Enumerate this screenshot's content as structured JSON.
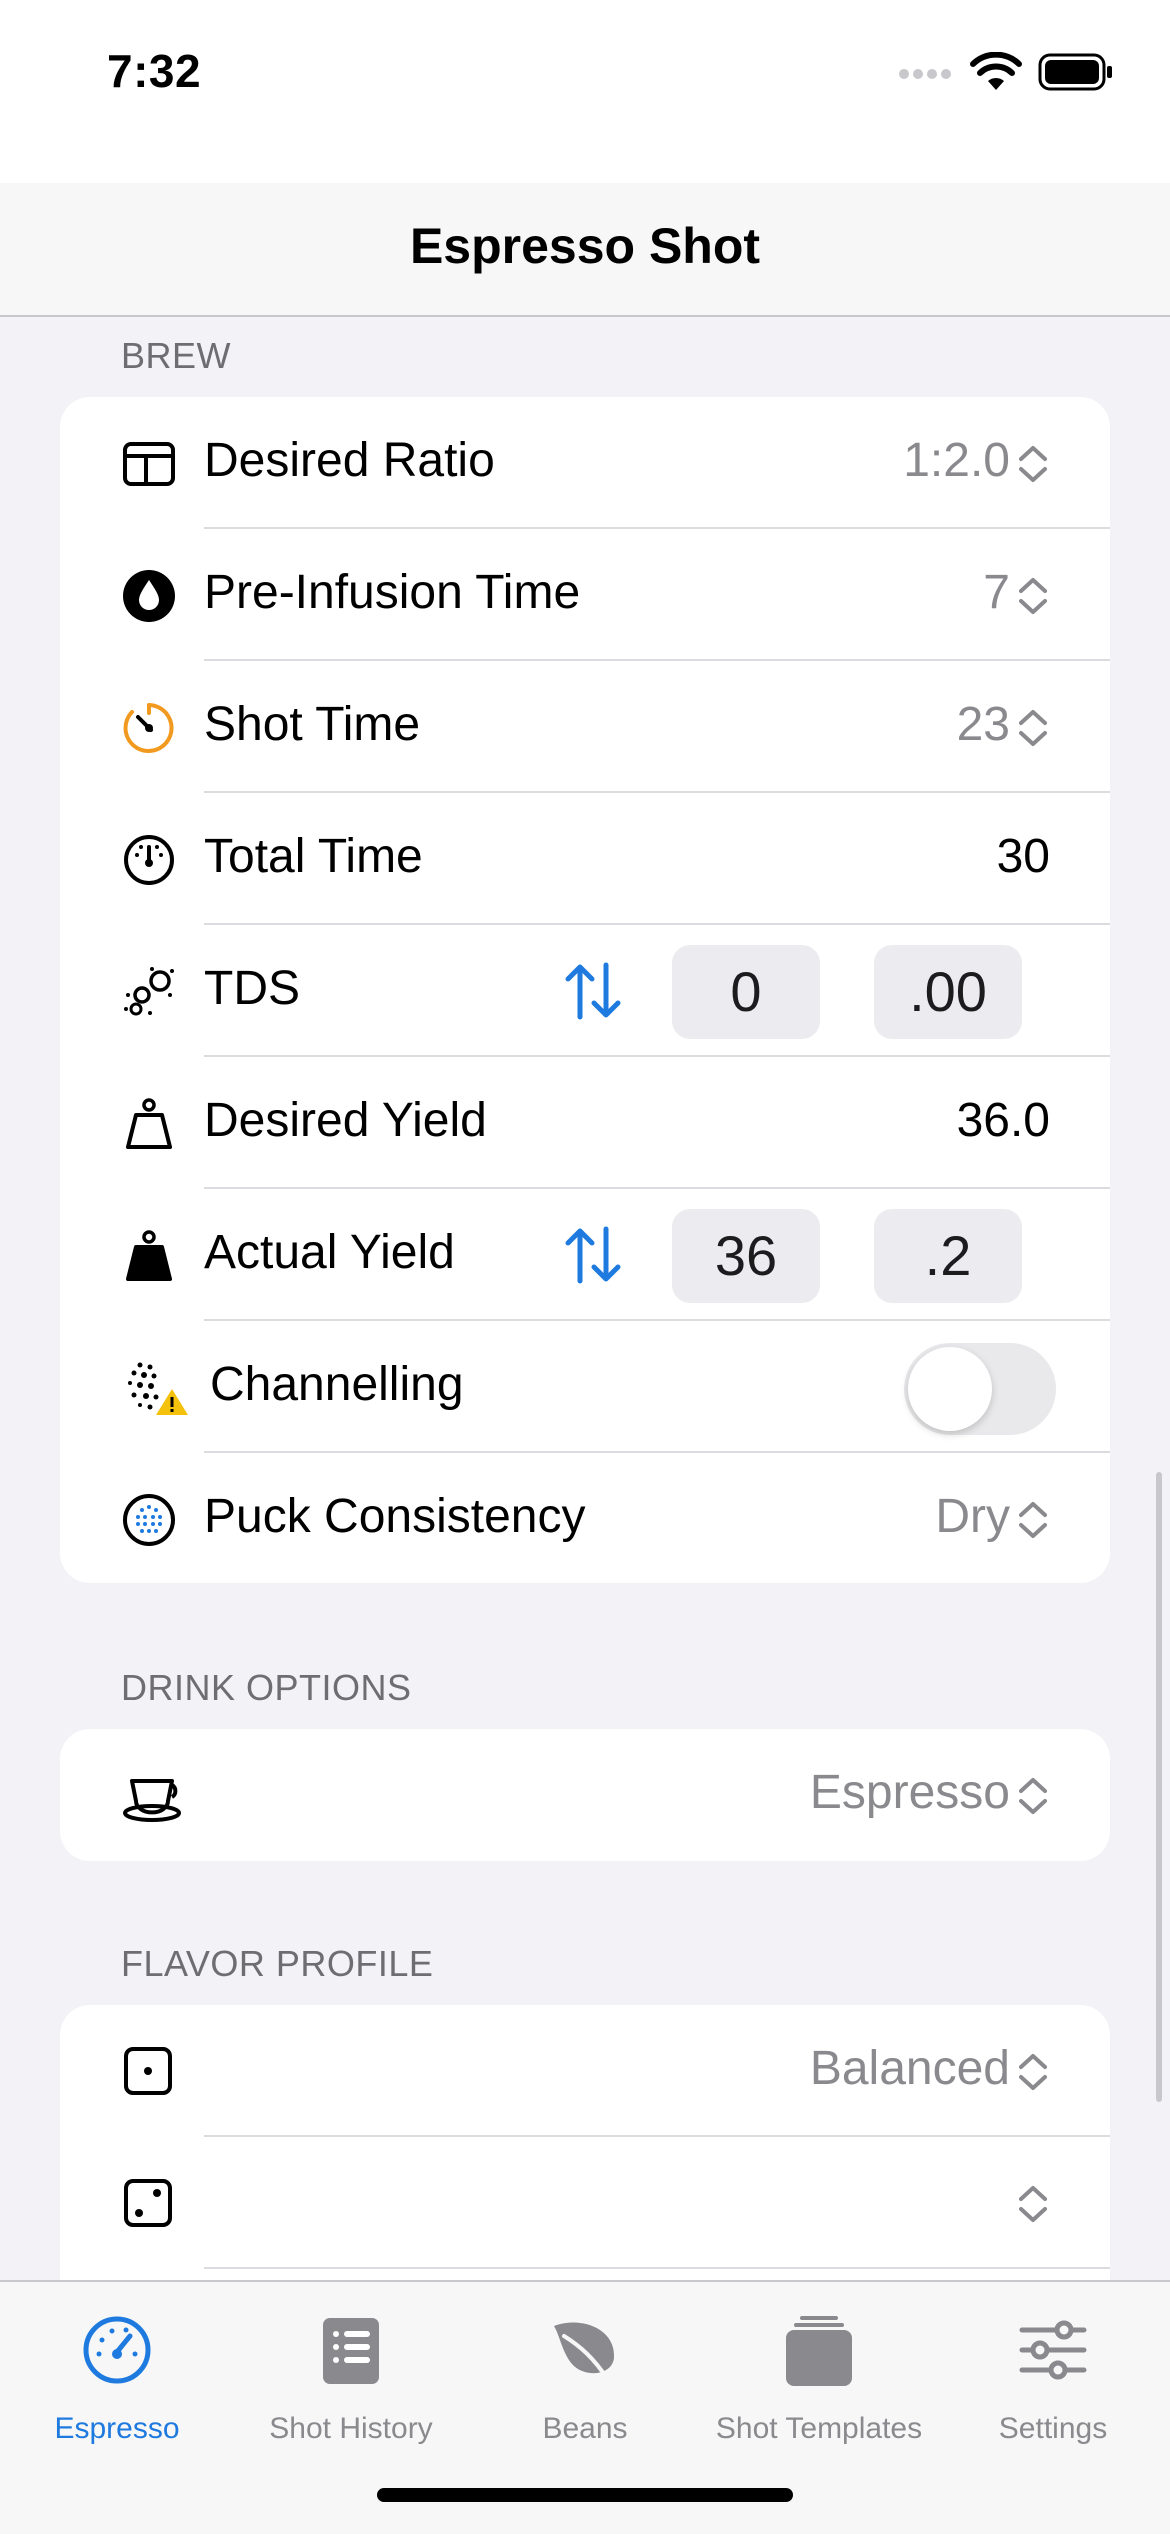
{
  "status": {
    "time": "7:32"
  },
  "nav": {
    "title": "Espresso Shot"
  },
  "sections": {
    "brew": {
      "header": "BREW",
      "rows": {
        "desired_ratio": {
          "label": "Desired Ratio",
          "value": "1:2.0",
          "icon": "ratio-icon"
        },
        "pre_infusion": {
          "label": "Pre-Infusion Time",
          "value": "7",
          "icon": "drop-icon"
        },
        "shot_time": {
          "label": "Shot Time",
          "value": "23",
          "icon": "timer-icon",
          "icon_color": "#f29a1f"
        },
        "total_time": {
          "label": "Total Time",
          "value": "30",
          "icon": "gauge-icon"
        },
        "tds": {
          "label": "TDS",
          "whole": "0",
          "fraction": ".00",
          "icon": "particles-icon"
        },
        "desired_yield": {
          "label": "Desired Yield",
          "value": "36.0",
          "icon": "weight-outline-icon"
        },
        "actual_yield": {
          "label": "Actual Yield",
          "whole": "36",
          "fraction": ".2",
          "icon": "weight-filled-icon"
        },
        "channelling": {
          "label": "Channelling",
          "on": false,
          "icon": "channelling-warning-icon"
        },
        "puck_consistency": {
          "label": "Puck Consistency",
          "value": "Dry",
          "icon": "puck-icon"
        }
      }
    },
    "drink_options": {
      "header": "DRINK OPTIONS",
      "rows": {
        "drink": {
          "value": "Espresso",
          "icon": "cup-icon"
        }
      }
    },
    "flavor_profile": {
      "header": "FLAVOR PROFILE",
      "rows": {
        "first": {
          "value": "Balanced",
          "icon": "dice-one-icon"
        },
        "second": {
          "value": "",
          "icon": "dice-two-icon"
        }
      }
    }
  },
  "tabs": [
    {
      "label": "Espresso",
      "icon": "speedometer-icon",
      "active": true
    },
    {
      "label": "Shot History",
      "icon": "list-icon",
      "active": false
    },
    {
      "label": "Beans",
      "icon": "leaf-icon",
      "active": false
    },
    {
      "label": "Shot Templates",
      "icon": "tray-stack-icon",
      "active": false
    },
    {
      "label": "Settings",
      "icon": "sliders-icon",
      "active": false
    }
  ],
  "colors": {
    "accent": "#1f7ae0",
    "secondary_text": "#8a8a8e",
    "background": "#f2f2f7"
  }
}
